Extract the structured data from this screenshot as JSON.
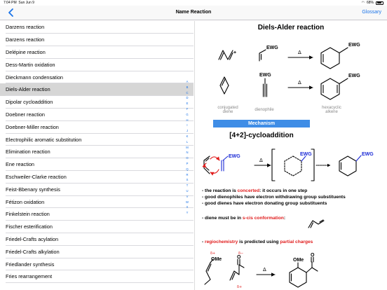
{
  "status_bar": {
    "time": "7:04 PM",
    "date": "Sun Jun 9",
    "battery": "68%",
    "battery_level": 0.68
  },
  "nav": {
    "title": "Name Reaction",
    "glossary": "Glossary"
  },
  "sidebar": {
    "items": [
      "Darzens reaction",
      "Darzens reaction",
      "Delépine reaction",
      "Dess-Martin oxidation",
      "Dieckmann condensation",
      "Diels-Alder reaction",
      "Dipolar cycloaddition",
      "Doebner reaction",
      "Doebner-Miller reaction",
      "Electrophilic aromatic substitution",
      "Elimination reaction",
      "Ene reaction",
      "Eschweiler-Clarke reaction",
      "Feist-Bbenary synthesis",
      "Fétizon oxidation",
      "Finkelstein reaction",
      "Fischer esterification",
      "Friedel-Crafts acylation",
      "Friedel-Crafts alkylation",
      "Friedlander synthesis",
      "Fries rearrangement"
    ],
    "selected_index": 5,
    "index_letters": [
      "A",
      "B",
      "C",
      "D",
      "E",
      "F",
      "G",
      "H",
      "I",
      "J",
      "K",
      "L",
      "M",
      "N",
      "O",
      "P",
      "Q",
      "R",
      "S",
      "T",
      "U",
      "V",
      "W",
      "X",
      "Y"
    ]
  },
  "detail": {
    "title": "Diels-Alder reaction",
    "ewg": "EWG",
    "plus": "+",
    "delta": "Δ",
    "labels": {
      "diene": "conjugated\ndiene",
      "dienophile": "dienophile",
      "product": "hexacyclic\nalkene"
    },
    "mechanism_button": "Mechanism",
    "subtitle": "[4+2]-cycloaddition",
    "notes": {
      "line1_a": "- the reaction is ",
      "line1_red": "concerted",
      "line1_b": ": it occurs in one step",
      "line2": "- good dienophiles have electron withdrawing group substituents",
      "line3": "- good dienes have electron donating group substituents",
      "line4_a": "- diene must be in ",
      "line4_red": "s-cis conformation",
      "line4_b": ":",
      "line5_a": "- ",
      "line5_red1": "regiochemistry",
      "line5_b": " is predicted using ",
      "line5_red2": "partial charges"
    },
    "regio": {
      "ome": "OMe",
      "delta_plus": "δ+",
      "delta_minus": "δ−",
      "o": "O"
    }
  },
  "colors": {
    "accent": "#1a73e8",
    "button": "#3f8de6",
    "red": "#e01b1b",
    "ewg_blue": "#1c2bd6",
    "selected_row": "#d6d6d6"
  }
}
